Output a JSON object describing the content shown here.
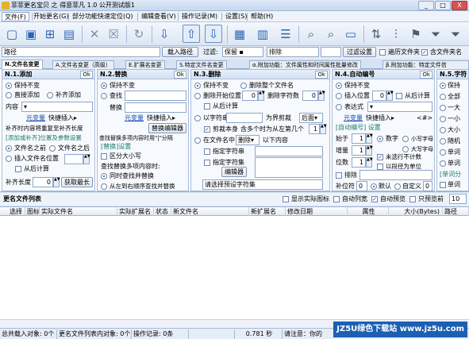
{
  "window": {
    "title": "菲菲更名宝贝 之 得意菲凡 1.0 公开测试版1",
    "min": "_",
    "max": "□",
    "close": "X"
  },
  "menu": [
    "文件(F)",
    "开始更名(G)",
    "部分功能快速定位(Q)",
    "编辑查看(V)",
    "操作记录(M)",
    "设置(S)",
    "帮助(H)"
  ],
  "toolbar_icons": [
    "new-icon",
    "add-folder-icon",
    "add-file-icon",
    "save-icon",
    "delete-icon",
    "clear-icon",
    "refresh-icon",
    "import-icon",
    "up-icon",
    "down-icon",
    "grid-icon",
    "grid-alt-icon",
    "list-icon",
    "search-icon",
    "search-alt-icon",
    "window-icon",
    "sort-icon",
    "adjust-icon",
    "flag-icon",
    "filter-icon",
    "filter-alt-icon"
  ],
  "pathbar": {
    "label": "路径",
    "load_button": "载入路径",
    "filter_label": "过滤:",
    "filter_value": "保留",
    "exclude_value": "排除",
    "apply_button": "过滤设置",
    "include_subfolder": "遍历文件夹",
    "include_ext": "含文件夹名"
  },
  "tabs": [
    "N.文件名变更",
    "A.文件名变更（高级）",
    "E.扩展名变更",
    "S.特定文件名变更",
    "α.附加功能：文件属性和时间属性批量修改",
    "β.附加功能：特定文件信"
  ],
  "g1": {
    "title": "N.1.添加",
    "ok": "Ok",
    "r_keep": "保持不变",
    "r_direct": "直接添加",
    "r_fill": "补齐添加",
    "content_label": "内容",
    "var_link": "元变量",
    "quick_insert": "快捷插入▸",
    "padding_note": "补齐时内容将重复至补齐长度",
    "pos_header": "[添加或补齐]位置及参数设置",
    "r_before": "文件名之前",
    "r_after": "文件名之后",
    "r_insert": "插入文件名位置",
    "from_right": "从后计算",
    "fill_len_label": "补齐长度",
    "fill_len_value": "0",
    "get_max": "获取最长"
  },
  "g2": {
    "title": "N.2.替换",
    "ok": "Ok",
    "r_keep": "保持不变",
    "find_label": "查找",
    "replace_label": "替换",
    "var_link": "元变量",
    "quick_insert": "快捷插入▸",
    "editor_button": "替换编辑器",
    "multi_note": "查找替换多项内容时用\"|\"分隔",
    "settings_header": "[替换]设置",
    "case": "区分大小写",
    "order_header": "查找替换多项内容时:",
    "r_sync": "同时查找并替换",
    "r_seq": "从左到右顺序查找并替换"
  },
  "g3": {
    "title": "N.3.删除",
    "ok": "Ok",
    "r_keep": "保持不变",
    "r_all": "删除整个文件名",
    "r_pos": "删除开始位置",
    "pos_value": "0",
    "r_count_label": "删除字符数",
    "count_value": "0",
    "from_right": "从后计算",
    "r_char": "以字符串",
    "boundary": "为界剪裁",
    "side": "后面",
    "cut_self": "剪裁本身",
    "max_times": "含多个时为从左第几个",
    "times_value": "1",
    "r_in_name": "在文件名中",
    "del_mode": "删除",
    "below": "以下内容",
    "specified_char": "指定字符串",
    "specified_set": "指定字符集",
    "editor": "编辑器",
    "preset": "请选择预设字符集"
  },
  "g4": {
    "title": "N.4.自动编号",
    "ok": "Ok",
    "r_keep": "保持不变",
    "r_insert": "插入位置",
    "pos_value": "0",
    "from_right": "从后计算",
    "r_expr": "表达式",
    "var_link": "元变量",
    "quick_insert": "快捷插入▸",
    "hash": "<#>",
    "settings": "[自动编号] 设置",
    "start_label": "始于",
    "start_value": "1",
    "r_num": "数字",
    "r_lower": "小写字母",
    "step_label": "增量",
    "step_value": "1",
    "r_upper": "大写字母",
    "skip_unit": "未选行不计数",
    "digits_label": "位数",
    "digits_value": "1",
    "pad_unit": "以段径为单位",
    "exclude": "排除",
    "fill_label": "补位符",
    "fill_value": "0",
    "r_default": "默认",
    "r_custom": "自定义",
    "custom_value": "0"
  },
  "g5": {
    "title": "N.5.字符",
    "items": [
      "保持",
      "全部",
      "一大",
      "一小",
      "大小",
      "随机",
      "单词",
      "单词",
      "[单词分",
      "单词"
    ]
  },
  "list": {
    "title": "更名文件列表",
    "show_icon": "显示实际图标",
    "auto_width": "自动列宽",
    "auto_preview": "自动预览",
    "preview_only": "只预览前",
    "preview_n": "10",
    "columns": [
      "选择",
      "图标",
      "实际文件名",
      "实际扩展名",
      "状态",
      "新文件名",
      "新扩展名",
      "修改日期",
      "属性",
      "大小(Bytes)",
      "路径"
    ]
  },
  "status": {
    "total": "总共载入对象: 0个",
    "list_count": "更名文件列表内对象: 0个",
    "ops": "操作记录: 0条",
    "time": "0.781 秒",
    "note": "请注意：你的",
    "watermark": "JZ5U绿色下载站 www.jz5u.com"
  }
}
